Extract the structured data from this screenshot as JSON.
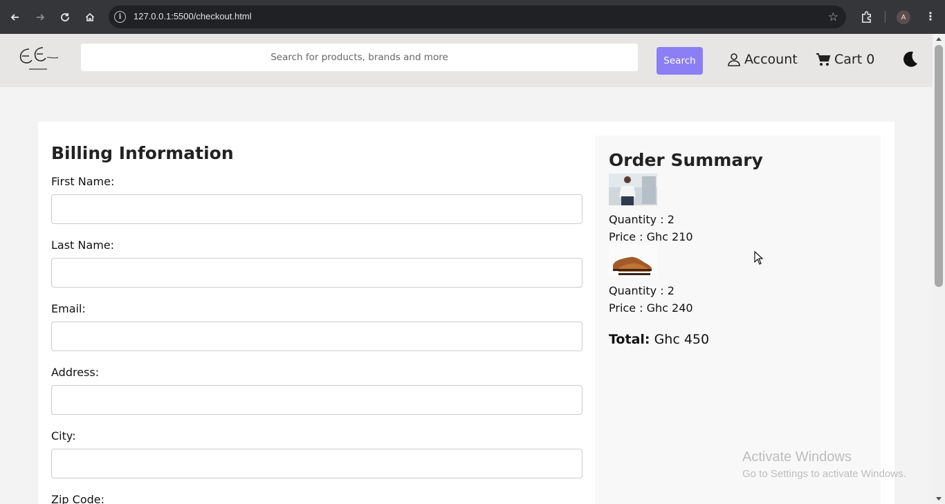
{
  "browser": {
    "url": "127.0.0.1:5500/checkout.html",
    "profile_initial": "A"
  },
  "header": {
    "search_placeholder": "Search for products, brands and more",
    "search_button": "Search",
    "account_label": "Account",
    "cart_label": "Cart 0"
  },
  "billing": {
    "title": "Billing Information",
    "fields": [
      {
        "label": "First Name:",
        "value": ""
      },
      {
        "label": "Last Name:",
        "value": ""
      },
      {
        "label": "Email:",
        "value": ""
      },
      {
        "label": "Address:",
        "value": ""
      },
      {
        "label": "City:",
        "value": ""
      },
      {
        "label": "Zip Code:",
        "value": ""
      }
    ]
  },
  "order_summary": {
    "title": "Order Summary",
    "items": [
      {
        "image": "man-in-white-shirt-photo",
        "quantity": "Quantity : 2",
        "price": "Price : Ghc 210"
      },
      {
        "image": "brown-leather-shoes-photo",
        "quantity": "Quantity : 2",
        "price": "Price : Ghc 240"
      }
    ],
    "total_label": "Total:",
    "total_value": "Ghc 450"
  },
  "watermark": {
    "line1": "Activate Windows",
    "line2": "Go to Settings to activate Windows."
  },
  "icons": {
    "back": "arrow-left-icon",
    "forward": "arrow-right-icon",
    "reload": "reload-icon",
    "home": "home-icon",
    "site_info": "info-icon",
    "bookmark": "star-icon",
    "extensions": "puzzle-icon",
    "browser_menu": "kebab-menu-icon",
    "account": "user-icon",
    "cart": "cart-icon",
    "theme": "moon-icon"
  },
  "colors": {
    "search_button_bg": "#8c7ef5",
    "header_bg": "#e8e6e4",
    "page_bg": "#f3f3f3"
  }
}
